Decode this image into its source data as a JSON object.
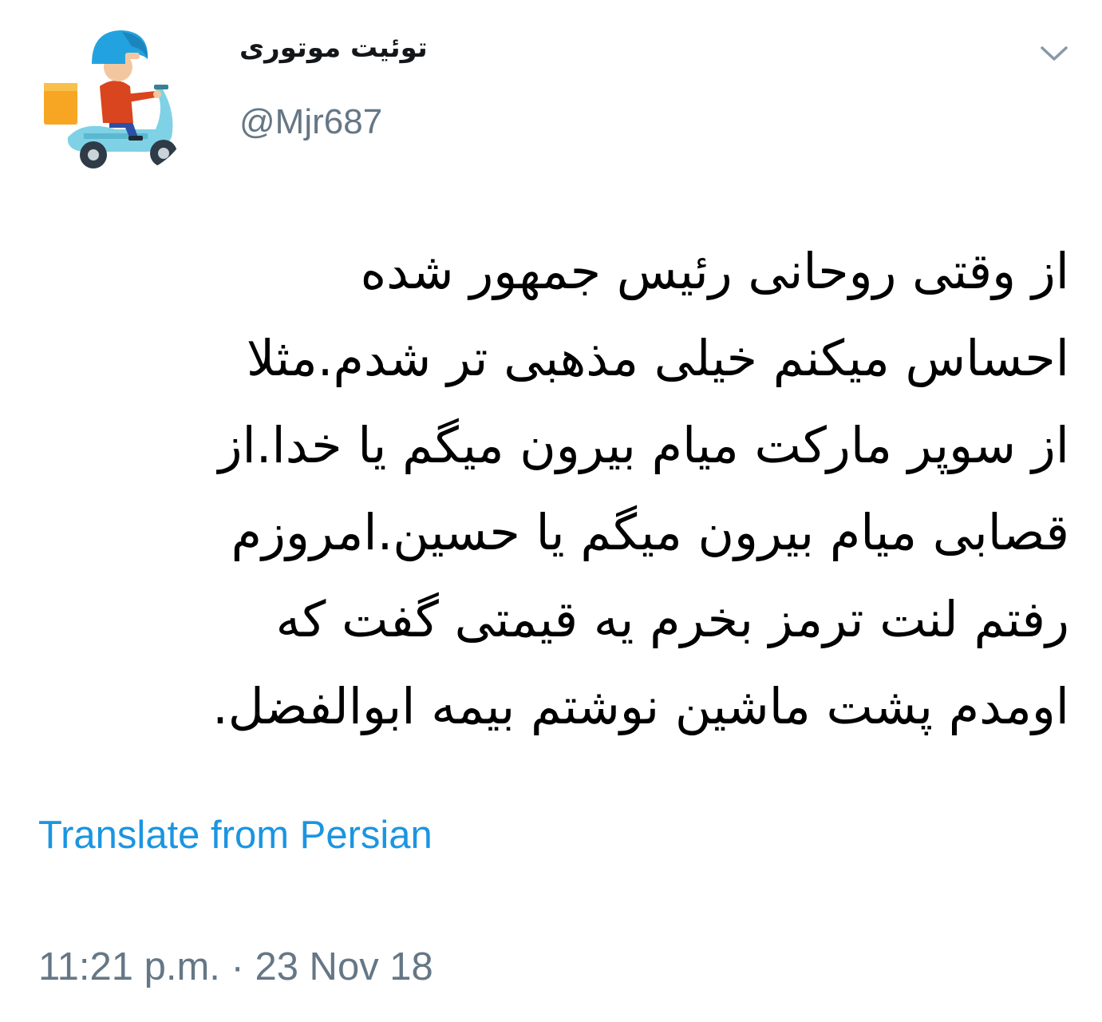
{
  "user": {
    "display_name": "توئیت موتوری",
    "handle": "@Mjr687",
    "avatar_icon": "scooter-rider-avatar-icon"
  },
  "menu": {
    "caret_icon": "chevron-down-icon"
  },
  "tweet": {
    "lines": [
      "از وقتی روحانی رئیس جمهور شده",
      "احساس میکنم خیلی مذهبی تر شدم.مثلا",
      "از سوپر مارکت میام بیرون میگم یا خدا.از",
      "قصابی میام بیرون میگم یا حسین.امروزم",
      "رفتم لنت ترمز بخرم یه قیمتی گفت که",
      "اومدم پشت ماشین نوشتم بیمه ابوالفضل."
    ],
    "translate_label": "Translate from Persian",
    "timestamp": "11:21 p.m. · 23 Nov 18"
  },
  "colors": {
    "link": "#1b95e0",
    "secondary_text": "#657786",
    "primary_text": "#000000"
  }
}
